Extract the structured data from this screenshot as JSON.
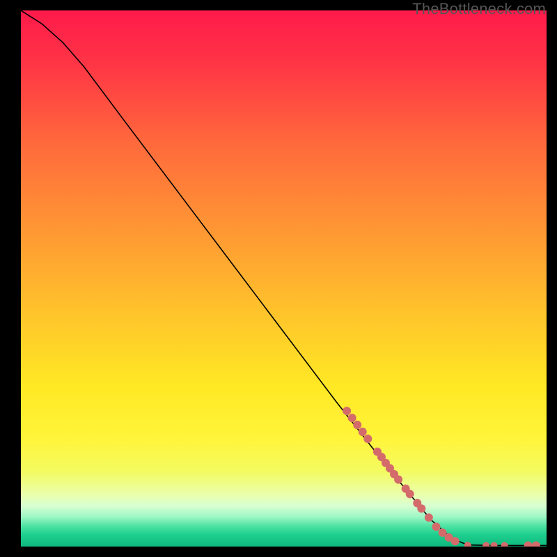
{
  "watermark": "TheBottleneck.com",
  "chart_data": {
    "type": "line",
    "title": "",
    "xlabel": "",
    "ylabel": "",
    "xlim": [
      0,
      100
    ],
    "ylim": [
      0,
      100
    ],
    "curve": [
      {
        "x": 0,
        "y": 100
      },
      {
        "x": 4,
        "y": 97.5
      },
      {
        "x": 8,
        "y": 94
      },
      {
        "x": 12,
        "y": 89.5
      },
      {
        "x": 20,
        "y": 79
      },
      {
        "x": 30,
        "y": 66
      },
      {
        "x": 40,
        "y": 53
      },
      {
        "x": 50,
        "y": 40
      },
      {
        "x": 60,
        "y": 27
      },
      {
        "x": 70,
        "y": 14.5
      },
      {
        "x": 78,
        "y": 5
      },
      {
        "x": 82,
        "y": 1.5
      },
      {
        "x": 85,
        "y": 0.3
      },
      {
        "x": 90,
        "y": 0.2
      },
      {
        "x": 95,
        "y": 0.2
      },
      {
        "x": 100,
        "y": 0.2
      }
    ],
    "markers": [
      {
        "x": 62,
        "y": 25.3,
        "r": 6
      },
      {
        "x": 63,
        "y": 24.0,
        "r": 6
      },
      {
        "x": 64,
        "y": 22.7,
        "r": 6
      },
      {
        "x": 65,
        "y": 21.4,
        "r": 6
      },
      {
        "x": 66,
        "y": 20.1,
        "r": 6
      },
      {
        "x": 67.8,
        "y": 17.7,
        "r": 6
      },
      {
        "x": 68.6,
        "y": 16.7,
        "r": 6
      },
      {
        "x": 69.4,
        "y": 15.6,
        "r": 6
      },
      {
        "x": 70.2,
        "y": 14.6,
        "r": 6
      },
      {
        "x": 71,
        "y": 13.5,
        "r": 6
      },
      {
        "x": 71.8,
        "y": 12.5,
        "r": 6
      },
      {
        "x": 73.2,
        "y": 10.8,
        "r": 6
      },
      {
        "x": 74,
        "y": 9.8,
        "r": 6
      },
      {
        "x": 75.4,
        "y": 8.1,
        "r": 6
      },
      {
        "x": 76.2,
        "y": 7.1,
        "r": 6
      },
      {
        "x": 77.6,
        "y": 5.4,
        "r": 6
      },
      {
        "x": 79,
        "y": 3.7,
        "r": 6
      },
      {
        "x": 80.2,
        "y": 2.6,
        "r": 6
      },
      {
        "x": 81.4,
        "y": 1.7,
        "r": 6
      },
      {
        "x": 82.6,
        "y": 1.0,
        "r": 6
      },
      {
        "x": 85,
        "y": 0.25,
        "r": 5
      },
      {
        "x": 88.5,
        "y": 0.2,
        "r": 5
      },
      {
        "x": 90,
        "y": 0.2,
        "r": 5
      },
      {
        "x": 92,
        "y": 0.2,
        "r": 5
      },
      {
        "x": 96.5,
        "y": 0.2,
        "r": 6
      },
      {
        "x": 98,
        "y": 0.2,
        "r": 6
      }
    ],
    "gradient_stops": [
      {
        "pct": 0.0,
        "color": "#ff1a4b"
      },
      {
        "pct": 0.1,
        "color": "#ff3545"
      },
      {
        "pct": 0.25,
        "color": "#ff6a3c"
      },
      {
        "pct": 0.42,
        "color": "#ff9a33"
      },
      {
        "pct": 0.58,
        "color": "#ffc82a"
      },
      {
        "pct": 0.7,
        "color": "#ffe824"
      },
      {
        "pct": 0.8,
        "color": "#fff53a"
      },
      {
        "pct": 0.86,
        "color": "#f3fb61"
      },
      {
        "pct": 0.905,
        "color": "#eaffb0"
      },
      {
        "pct": 0.925,
        "color": "#d6ffd2"
      },
      {
        "pct": 0.945,
        "color": "#9cf7c4"
      },
      {
        "pct": 0.962,
        "color": "#4de2a3"
      },
      {
        "pct": 0.978,
        "color": "#1ecf8f"
      },
      {
        "pct": 1.0,
        "color": "#0fb87d"
      }
    ],
    "marker_color": "#d46b6b",
    "line_color": "#000000"
  }
}
